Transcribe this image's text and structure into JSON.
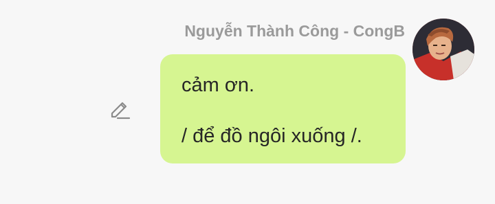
{
  "message": {
    "sender_name": "Nguyễn Thành Công - CongB",
    "lines": [
      "cảm ơn.",
      "/ để đồ ngôi xuống /."
    ],
    "bubble_color": "#d6f591",
    "text_color": "#262626"
  },
  "icons": {
    "edit": "pencil-icon",
    "avatar": "user-avatar-photo"
  },
  "colors": {
    "background": "#f7f7f7",
    "sender_name": "#9a9a9a"
  }
}
